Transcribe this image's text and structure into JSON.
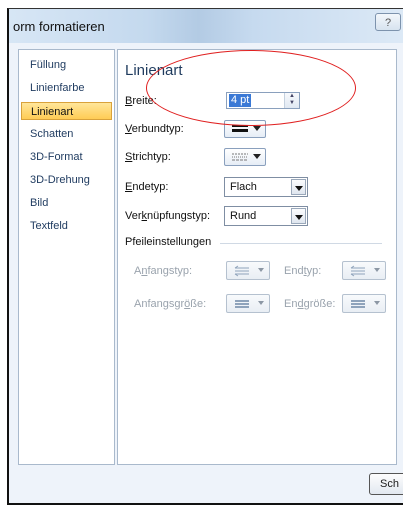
{
  "window": {
    "title": "orm formatieren",
    "help_label": "?"
  },
  "nav": {
    "items": [
      {
        "label": "Füllung",
        "active": false
      },
      {
        "label": "Linienfarbe",
        "active": false
      },
      {
        "label": "Linienart",
        "active": true
      },
      {
        "label": "Schatten",
        "active": false
      },
      {
        "label": "3D-Format",
        "active": false
      },
      {
        "label": "3D-Drehung",
        "active": false
      },
      {
        "label": "Bild",
        "active": false
      },
      {
        "label": "Textfeld",
        "active": false
      }
    ]
  },
  "panel": {
    "title": "Linienart",
    "width": {
      "label_u": "B",
      "label_rest": "reite:",
      "value": "4 pt"
    },
    "compound": {
      "label_u": "V",
      "label_rest": "erbundtyp:"
    },
    "dash": {
      "label_u": "S",
      "label_rest": "trichtyp:"
    },
    "cap": {
      "label_u": "E",
      "label_rest": "ndetyp:",
      "value": "Flach"
    },
    "join": {
      "label_pre": "Ver",
      "label_u": "k",
      "label_rest": "nüpfungstyp:",
      "value": "Rund"
    },
    "arrow_heading": "Pfeileinstellungen",
    "begin_type": {
      "label_pre": "A",
      "label_u": "n",
      "label_rest": "fangstyp:"
    },
    "end_type": {
      "label_pre": "End",
      "label_u": "t",
      "label_rest": "yp:"
    },
    "begin_size": {
      "label_pre": "Anfangsgr",
      "label_u": "ö",
      "label_rest": "ße:"
    },
    "end_size": {
      "label_pre": "En",
      "label_u": "d",
      "label_rest": "größe:"
    }
  },
  "footer": {
    "close_label": "Sch"
  },
  "colors": {
    "accent": "#ffcc55",
    "annotation": "#e02020",
    "selection": "#3a79d6"
  }
}
